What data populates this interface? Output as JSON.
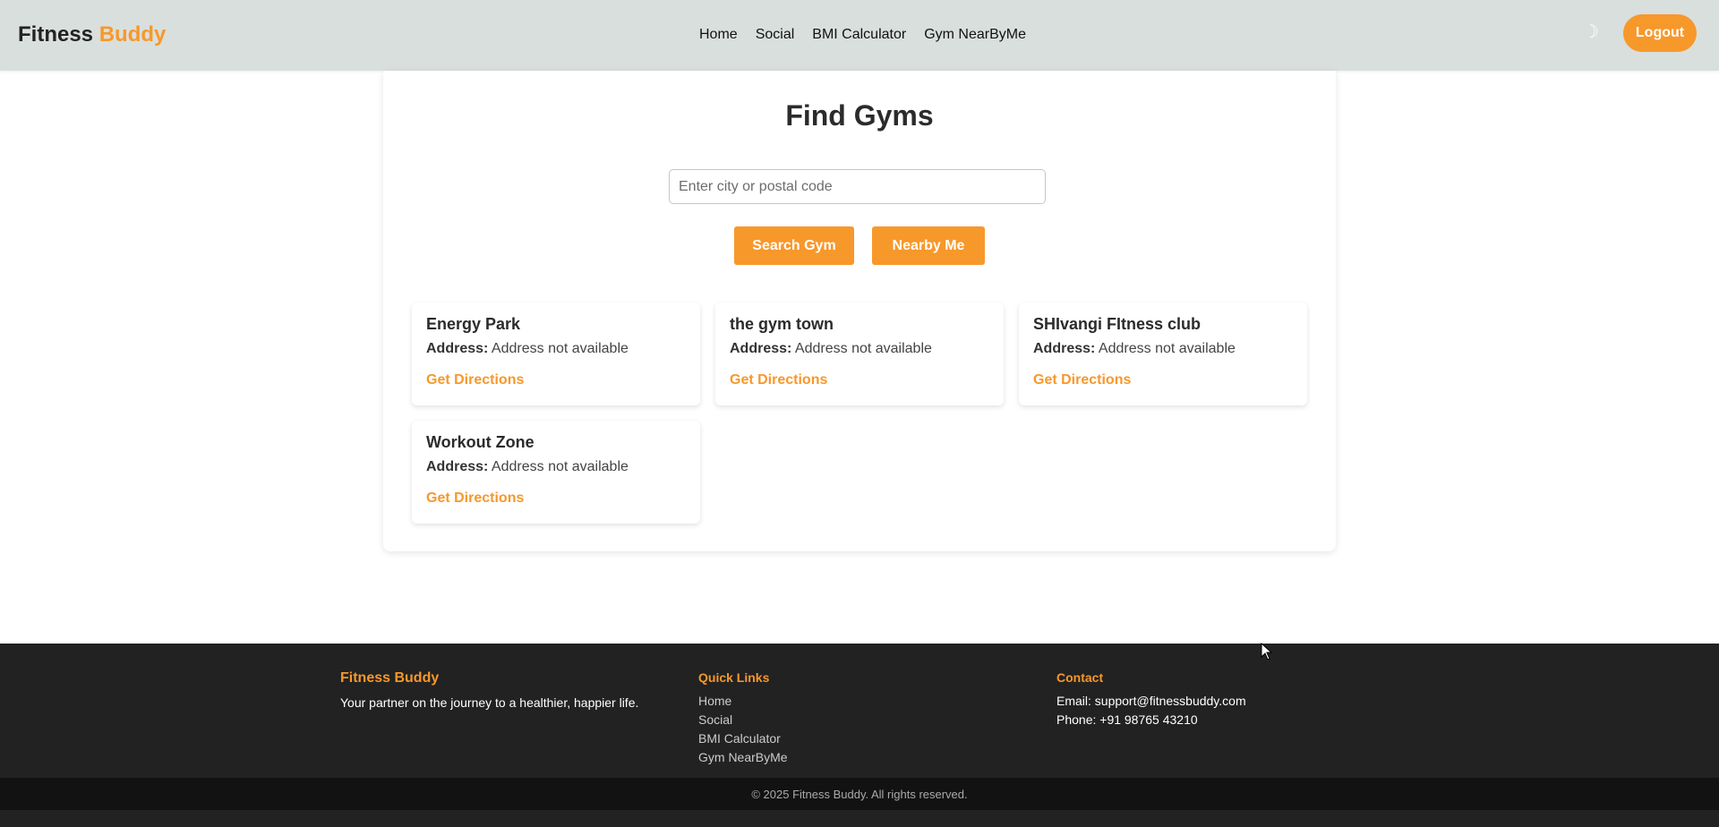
{
  "header": {
    "brand_main": "Fitness",
    "brand_accent": "Buddy",
    "nav": [
      {
        "label": "Home"
      },
      {
        "label": "Social"
      },
      {
        "label": "BMI Calculator"
      },
      {
        "label": "Gym NearByMe"
      }
    ],
    "theme_toggle_icon": "☽",
    "logout_label": "Logout"
  },
  "main": {
    "title": "Find Gyms",
    "search_placeholder": "Enter city or postal code",
    "search_value": "",
    "search_button": "Search Gym",
    "nearby_button": "Nearby Me",
    "gyms": [
      {
        "name": "Energy Park",
        "address_label": "Address:",
        "address": "Address not available",
        "directions": "Get Directions"
      },
      {
        "name": "the gym town",
        "address_label": "Address:",
        "address": "Address not available",
        "directions": "Get Directions"
      },
      {
        "name": "SHIvangi FItness club",
        "address_label": "Address:",
        "address": "Address not available",
        "directions": "Get Directions"
      },
      {
        "name": "Workout Zone",
        "address_label": "Address:",
        "address": "Address not available",
        "directions": "Get Directions"
      }
    ]
  },
  "footer": {
    "brand": "Fitness Buddy",
    "tagline": "Your partner on the journey to a healthier, happier life.",
    "quick_links_heading": "Quick Links",
    "quick_links": [
      "Home",
      "Social",
      "BMI Calculator",
      "Gym NearByMe"
    ],
    "contact_heading": "Contact",
    "email": "Email: support@fitnessbuddy.com",
    "phone": "Phone: +91 98765 43210",
    "copyright": "© 2025 Fitness Buddy. All rights reserved."
  },
  "colors": {
    "accent": "#f7982b",
    "header_bg": "#d9dfdc",
    "footer_bg": "#222222"
  }
}
